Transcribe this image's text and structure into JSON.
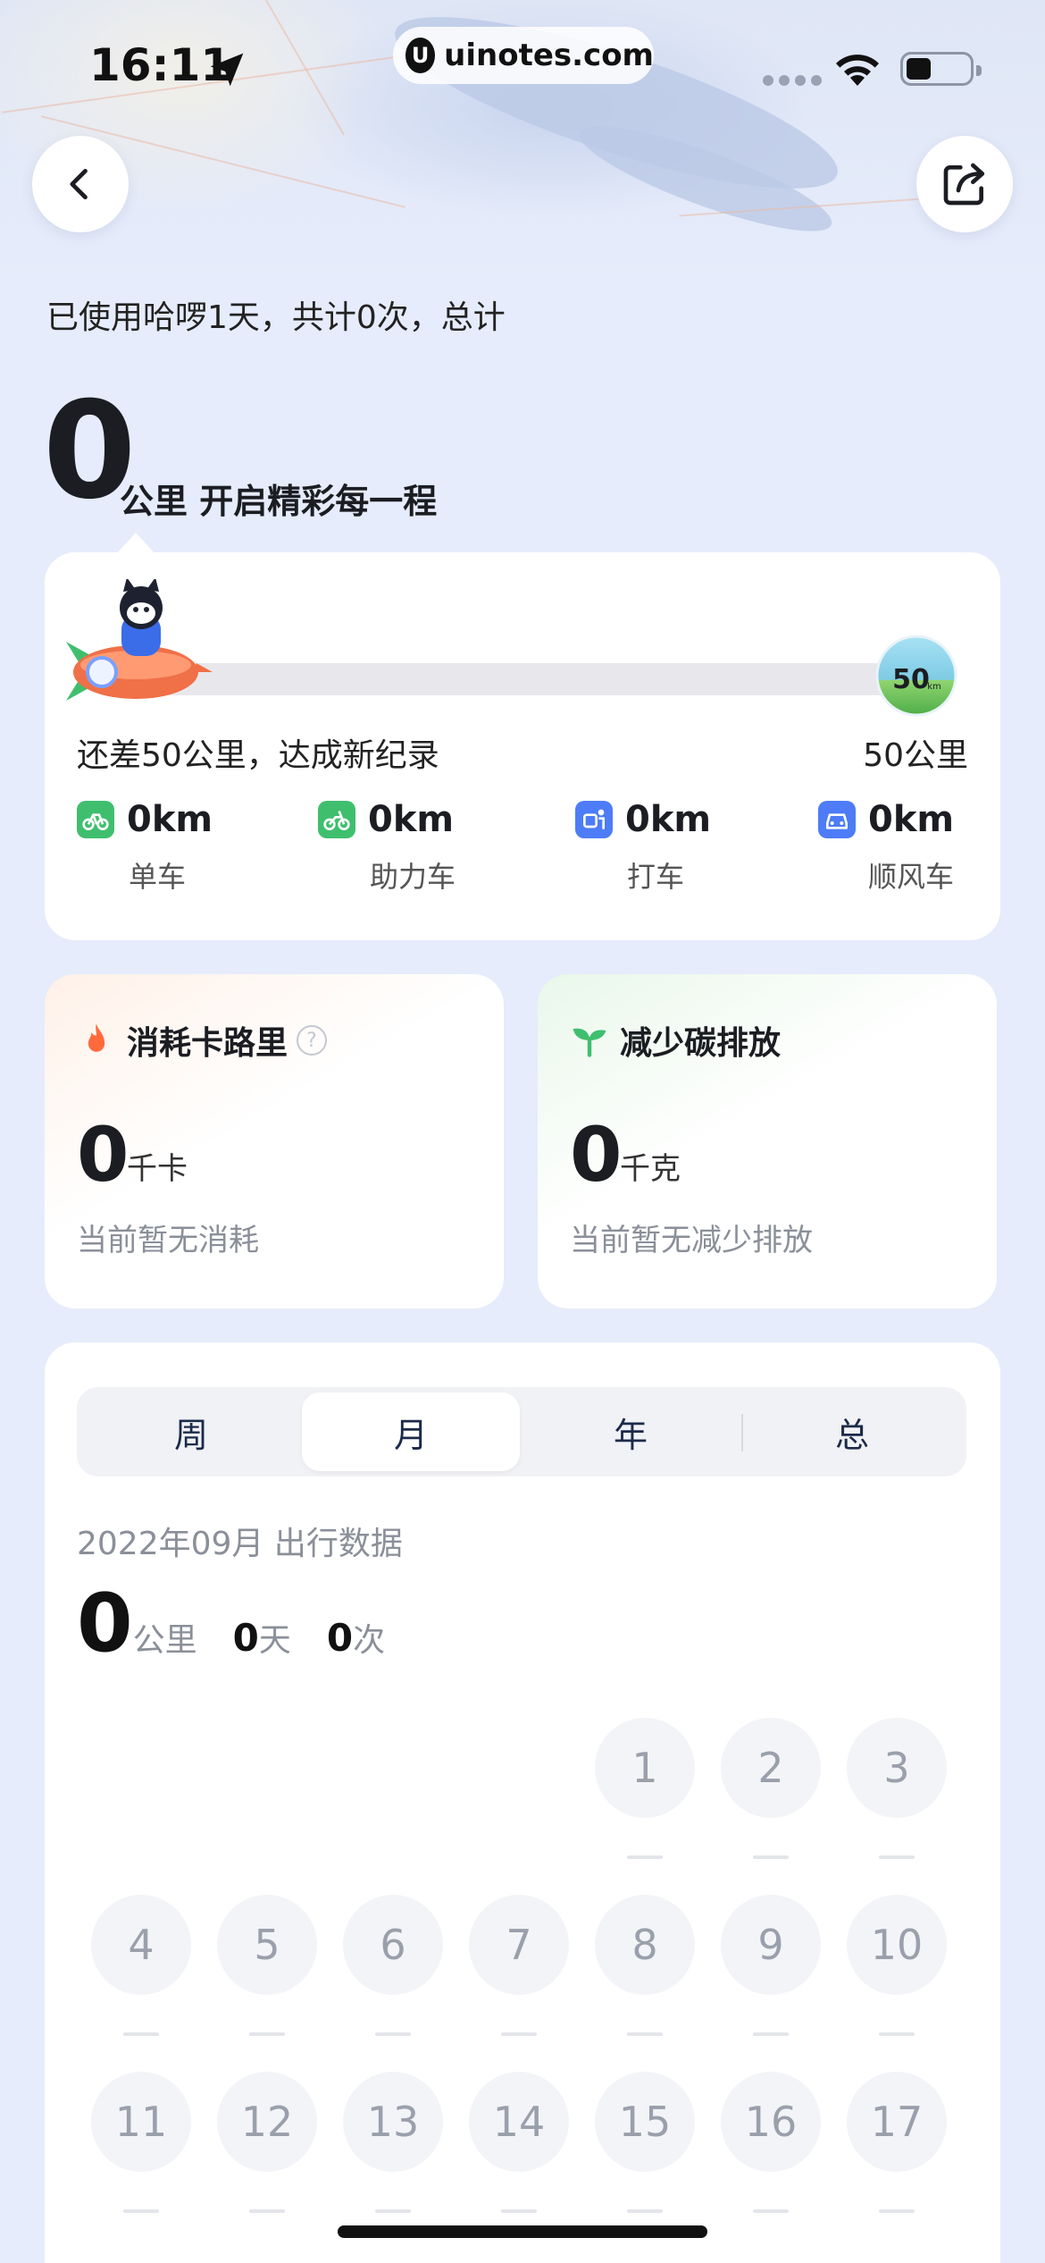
{
  "status_bar": {
    "time": "16:11",
    "url": "uinotes.com"
  },
  "summary": {
    "usage_text": "已使用哈啰1天，共计0次，总计",
    "total_km": "0",
    "total_unit_text": "公里 开启精彩每一程"
  },
  "progress": {
    "value_fraction": 0,
    "remain_text": "还差50公里，达成新纪录",
    "goal_text": "50公里",
    "badge_text": "50",
    "badge_unit": "km"
  },
  "modes": [
    {
      "value": "0km",
      "label": "单车",
      "icon": "bike-icon",
      "color": "#3fbf6e"
    },
    {
      "value": "0km",
      "label": "助力车",
      "icon": "ebike-icon",
      "color": "#3fbf6e"
    },
    {
      "value": "0km",
      "label": "打车",
      "icon": "taxi-icon",
      "color": "#4d7cf6"
    },
    {
      "value": "0km",
      "label": "顺风车",
      "icon": "car-icon",
      "color": "#4d7cf6"
    }
  ],
  "calories": {
    "title": "消耗卡路里",
    "value": "0",
    "unit": "千卡",
    "desc": "当前暂无消耗"
  },
  "carbon": {
    "title": "减少碳排放",
    "value": "0",
    "unit": "千克",
    "desc": "当前暂无减少排放"
  },
  "stats": {
    "tabs": [
      "周",
      "月",
      "年",
      "总"
    ],
    "active_tab": "月",
    "month_title": "2022年09月 出行数据",
    "km": "0",
    "km_unit": "公里",
    "days": "0",
    "days_unit": "天",
    "times": "0",
    "times_unit": "次"
  },
  "calendar": {
    "row1": [
      "1",
      "2",
      "3"
    ],
    "row2": [
      "4",
      "5",
      "6",
      "7",
      "8",
      "9",
      "10"
    ],
    "row3": [
      "11",
      "12",
      "13",
      "14",
      "15",
      "16",
      "17"
    ]
  },
  "colors": {
    "accent_green": "#3fbf6e",
    "accent_blue": "#4d7cf6",
    "fire": "#ff6a3d"
  }
}
